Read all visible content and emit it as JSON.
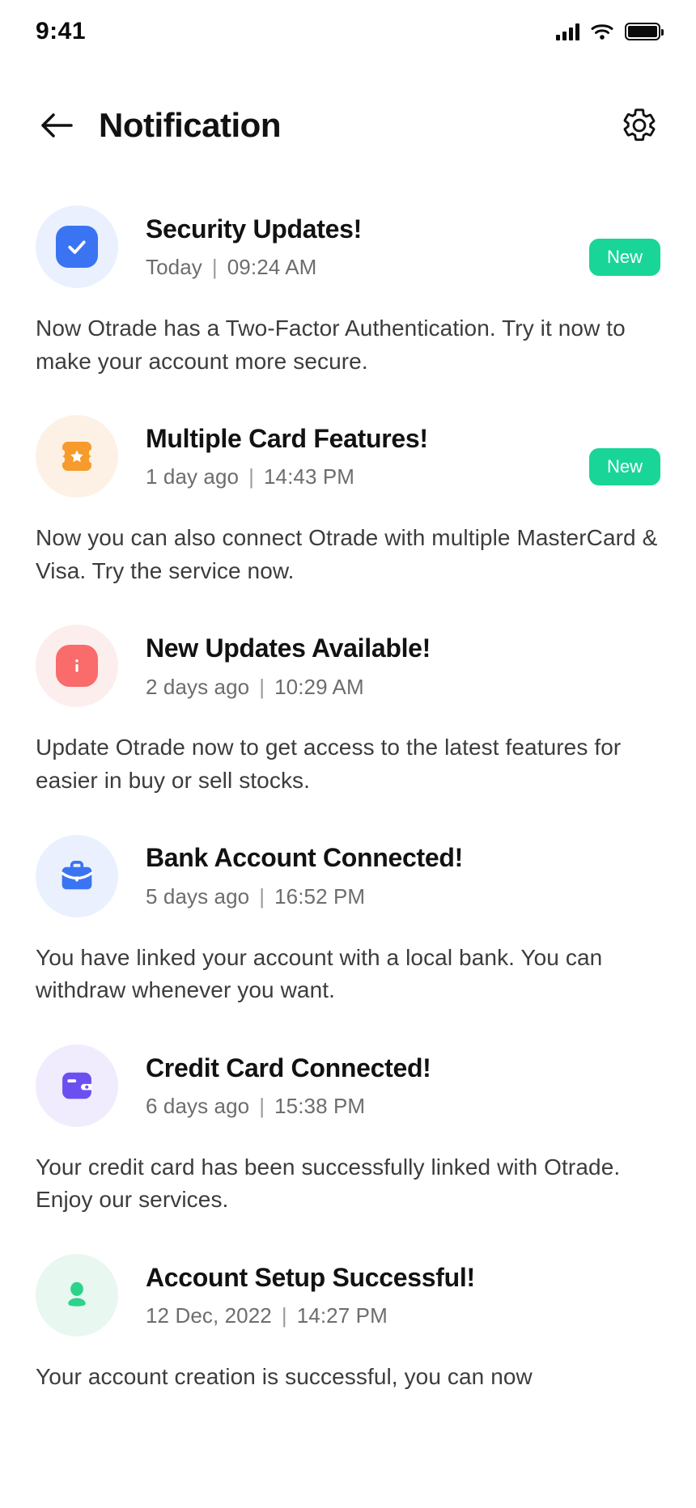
{
  "status_bar": {
    "time": "9:41",
    "signal_icon": "cellular-signal-icon",
    "wifi_icon": "wifi-icon",
    "battery_icon": "battery-full-icon"
  },
  "header": {
    "back_icon": "arrow-left-icon",
    "title": "Notification",
    "settings_icon": "gear-icon"
  },
  "colors": {
    "badge_green": "#1ad598",
    "icon_blue": "#3b74f2",
    "icon_orange": "#f79b2c",
    "icon_red": "#fa6b6b",
    "icon_purple": "#6c4ff0",
    "icon_green": "#2cd38a"
  },
  "notifications": [
    {
      "icon": "check-square-icon",
      "icon_color": "#3b74f2",
      "icon_bg": "#eaf0fe",
      "title": "Security Updates!",
      "date": "Today",
      "time": "09:24 AM",
      "badge": "New",
      "body": "Now Otrade has a Two-Factor Authentication. Try it now to make your account more secure."
    },
    {
      "icon": "ticket-star-icon",
      "icon_color": "#f79b2c",
      "icon_bg": "#fdf1e6",
      "title": "Multiple Card Features!",
      "date": "1 day ago",
      "time": "14:43 PM",
      "badge": "New",
      "body": "Now you can also connect Otrade with multiple MasterCard & Visa. Try the service now."
    },
    {
      "icon": "info-square-icon",
      "icon_color": "#fa6b6b",
      "icon_bg": "#fdeeee",
      "title": "New Updates Available!",
      "date": "2 days ago",
      "time": "10:29 AM",
      "badge": "",
      "body": "Update Otrade now to get access to the latest features for easier in buy or sell stocks."
    },
    {
      "icon": "briefcase-icon",
      "icon_color": "#3b74f2",
      "icon_bg": "#eaf0fe",
      "title": "Bank Account Connected!",
      "date": "5 days ago",
      "time": "16:52 PM",
      "badge": "",
      "body": "You have linked your account with a local bank. You can withdraw whenever you want."
    },
    {
      "icon": "wallet-icon",
      "icon_color": "#6c4ff0",
      "icon_bg": "#f0ecfe",
      "title": "Credit Card Connected!",
      "date": "6 days ago",
      "time": "15:38 PM",
      "badge": "",
      "body": "Your credit card has been successfully linked with Otrade. Enjoy our services."
    },
    {
      "icon": "person-icon",
      "icon_color": "#2cd38a",
      "icon_bg": "#e8f7f0",
      "title": "Account Setup Successful!",
      "date": "12 Dec, 2022",
      "time": "14:27 PM",
      "badge": "",
      "body": "Your account creation is successful, you can now"
    }
  ]
}
